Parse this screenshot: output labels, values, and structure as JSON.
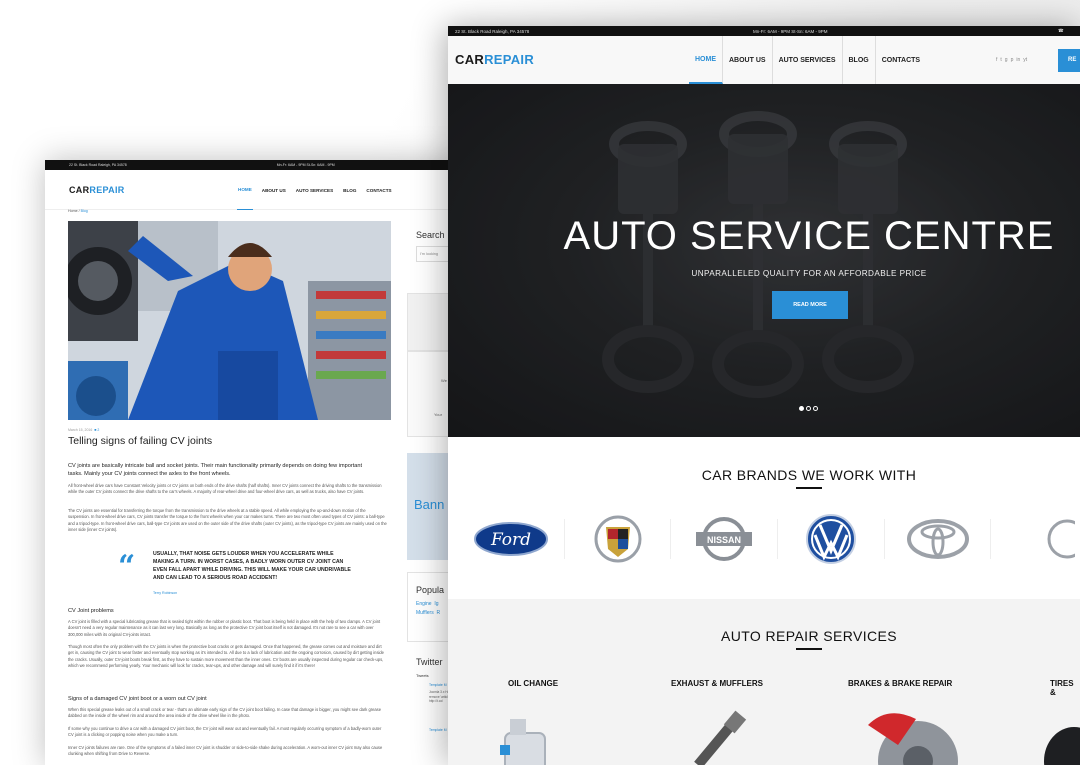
{
  "back": {
    "topbar": {
      "address": "22 St. Black Road Raleigh, PA 34578",
      "hours": "Mn-Fr: 6AM - 9PM   St-Sn: 6AM - 9PM"
    },
    "logo": {
      "part1": "CAR",
      "part2": "REPAIR"
    },
    "nav": [
      "HOME",
      "ABOUT US",
      "AUTO SERVICES",
      "BLOG",
      "CONTACTS"
    ],
    "breadcrumb": {
      "home": "Home",
      "current": "Blog"
    },
    "post": {
      "date": "March 15, 2016",
      "comments": "2",
      "title": "Telling signs of failing CV joints",
      "lead": "CV joints are basically intricate ball and socket joints. Their main functionality primarily depends on doing few important tasks. Mainly your CV joints connect the axles to the front wheels.",
      "p1": "All front-wheel drive cars have Constant Velocity joints or CV joints on both ends of the drive shafts (half shafts). Inner CV joints connect the driving shafts to the transmission while the outer CV joints connect the drive shafts to the car's wheels. A majority of rear-wheel drive and four-wheel drive cars, as well as trucks, also have CV joints.",
      "p2": "The CV joints are essential for transferring the torque from the transmission to the drive wheels at a stable speed. All while employing the up-and-down motion of the suspension. In front-wheel drive cars, CV joints transfer the torque to the front wheels when your car makes turns. There are two most often used types of CV joints: a ball-type and a tripod-type. In front-wheel drive cars, ball-type CV joints are used on the outer side of the drive shafts (outer CV joints), as the tripod-type CV joints are mainly used on the inner side (inner CV joints).",
      "quote": "USUALLY, THAT NOISE GETS LOUDER WHEN YOU ACCELERATE WHILE MAKING A TURN. IN WORST CASES, A BADLY WORN OUTER CV JOINT CAN EVEN FALL APART WHILE DRIVING. THIS WILL MAKE YOUR CAR UNDRIVABLE AND CAN LEAD TO A SERIOUS ROAD ACCIDENT!",
      "quote_author": "Terry Robinson",
      "h3a": "CV Joint problems",
      "p3": "A CV joint is filled with a special lubricating grease that is sealed tight within the rubber or plastic boot. That boot is being held in place with the help of two clamps. A CV joint doesn't need a very regular maintenance as it can last very long. Basically as long as the protective CV joint boot itself is not damaged. It's not rare to see a car with over 300,000 miles with its original CV-joints intact.",
      "p4": "Though most often the only problem with the CV joints is when the protective boot cracks or gets damaged. Once that happened, the grease comes out and moisture and dirt get in, causing the CV joint to wear faster and eventually stop working as it's intended to. All due to a lack of lubrication and the ongoing corrosion, caused by dirt getting inside the cracks. Usually, outer CV-joint boots break first, as they have to sustain more movement than the inner ones. CV boots are usually inspected during regular car check-ups, which we recommend performing yearly. Your mechanic will look for cracks, tear-ups, and other damage and will surely find it if it's there!",
      "h3b": "Signs of a damaged CV joint boot or a worn out CV joint",
      "p5": "When this special grease leaks out of a small crack or tear - that's an ultimate early sign of the CV joint boot failing. In case that damage is bigger, you might see dark grease dabbed on the inside of the wheel rim and around the area inside of the drive wheel like in the photo.",
      "p6": "If some why you continue to drive a car with a damaged CV joint boot, the CV joint will wear out and eventually fail. A most regularly occurring symptom of a badly-worn outer CV joint is a clicking or popping noise when you make a turn.",
      "p7": "Inner CV joints failures are rare. One of the symptoms of a failed inner CV joint is shudder or side-to-side shake during acceleration. A worn-out inner CV joint may also cause clunking when shifting from Drive to Reverse."
    },
    "sidebar": {
      "search_title": "Search",
      "search_placeholder": "I'm looking",
      "widget_a": "We",
      "widget_b": "Your",
      "banner": "Bann",
      "popular_title": "Popula",
      "popular_tags": [
        "Engine",
        "Ig",
        "Mufflers",
        "R"
      ],
      "twitter_title": "Twitter",
      "tweets_label": "Tweets",
      "tweet_author": "Template M",
      "tweet_text": "Joomla 3.x How-to: remove 'article' ar... http://t.co/"
    }
  },
  "front": {
    "topbar": {
      "address": "22 St. Black Road Raleigh, PA 34578",
      "hours": "Mn-Fr: 6AM - 9PM   St-Sn: 6AM - 9PM",
      "phone": "☎"
    },
    "logo": {
      "part1": "CAR",
      "part2": "REPAIR"
    },
    "nav": [
      "HOME",
      "ABOUT US",
      "AUTO SERVICES",
      "BLOG",
      "CONTACTS"
    ],
    "social": [
      "f",
      "t",
      "g",
      "p",
      "in",
      "yt"
    ],
    "cta": "RE",
    "hero": {
      "title": "AUTO SERVICE CENTRE",
      "subtitle": "UNPARALLELED QUALITY FOR AN AFFORDABLE PRICE",
      "button": "READ MORE"
    },
    "brands_title": "CAR BRANDS WE WORK WITH",
    "brands": [
      "Ford",
      "NISSAN"
    ],
    "services_title": "AUTO REPAIR SERVICES",
    "services": [
      "OIL CHANGE",
      "EXHAUST & MUFFLERS",
      "BRAKES & BRAKE REPAIR",
      "TIRES &"
    ]
  }
}
